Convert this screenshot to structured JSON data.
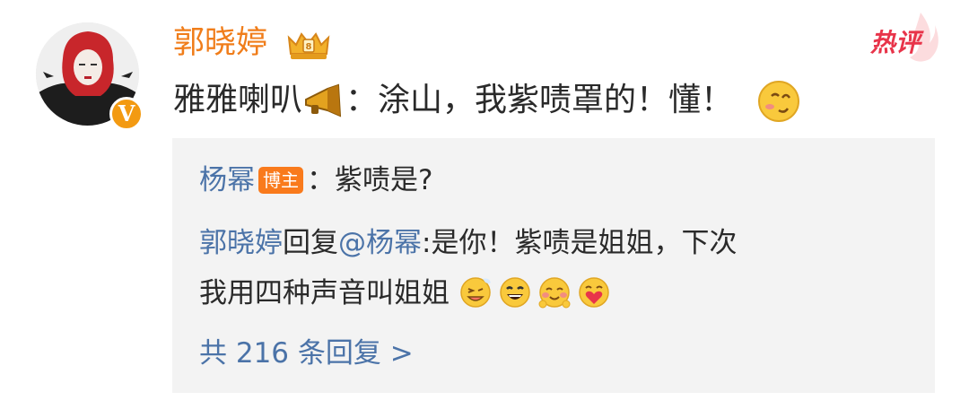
{
  "comment": {
    "username": "郭晓婷",
    "user_badge_icon": "vip-crown-icon",
    "avatar_verified_icon": "verified-v-icon",
    "verified_letter": "V",
    "hot_tag": "热评",
    "text_prefix": "雅雅喇叭",
    "text_body": "：涂山，我紫啧罩的！懂！",
    "prefix_icon": "megaphone-icon",
    "trailing_emoji": "smirk-emoji-icon"
  },
  "replies": [
    {
      "author": "杨幂",
      "author_badge": "博主",
      "text": "：紫啧是?"
    },
    {
      "author": "郭晓婷",
      "action": "回复",
      "mention": "@杨幂",
      "text_line1": ":是你！紫啧是姐姐，下次",
      "text_line2": "我用四种声音叫姐姐"
    }
  ],
  "more_replies": "共 216 条回复 >",
  "colors": {
    "username_orange": "#f07d1a",
    "link_blue": "#4b73a8",
    "hot_red": "#e8344a",
    "reply_bg": "#f3f3f3"
  }
}
